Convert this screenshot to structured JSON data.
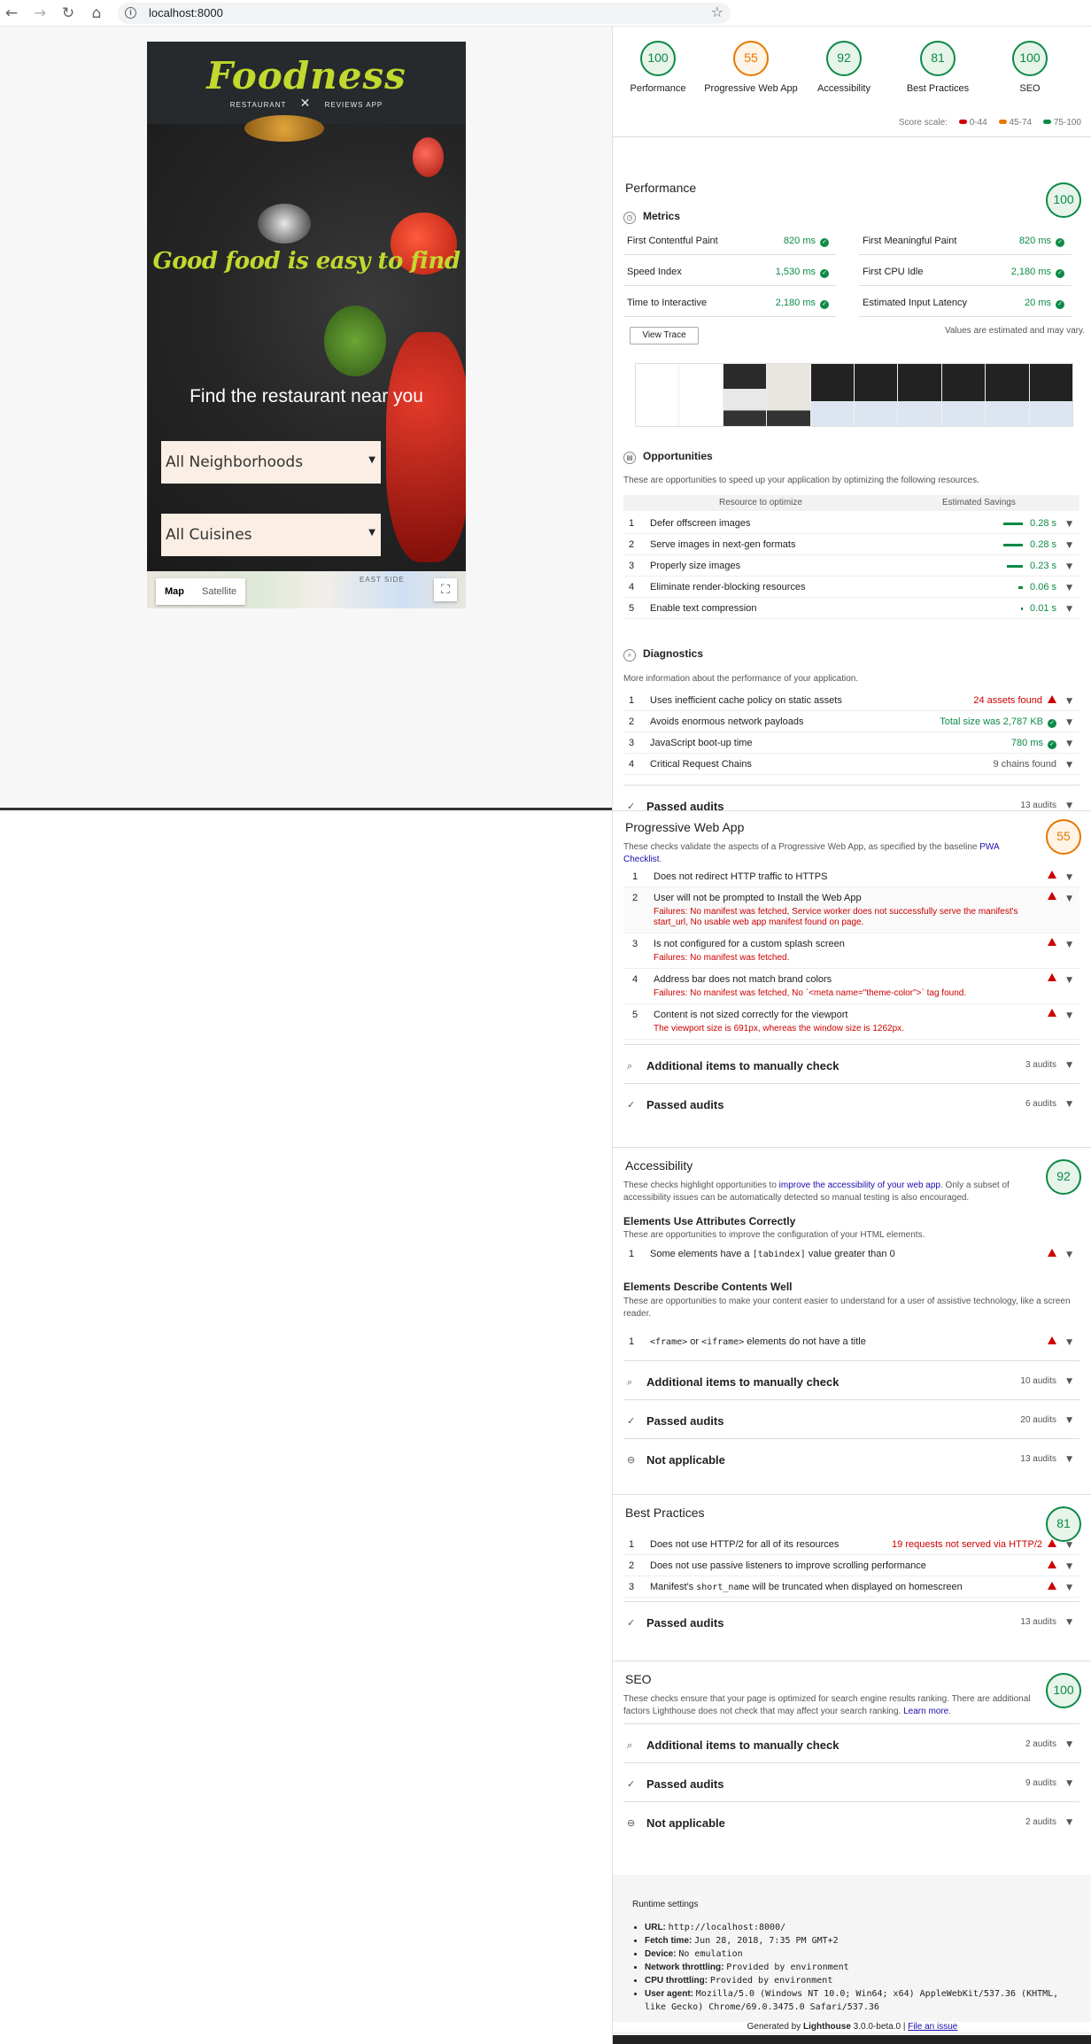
{
  "browser": {
    "url": "localhost:8000"
  },
  "app": {
    "logo": "Foodness",
    "logo_left": "RESTAURANT",
    "logo_right": "REVIEWS APP",
    "hero_title": "Good food is easy to find",
    "hero_subtitle": "Find the restaurant near you",
    "neighborhoods_select": "All Neighborhoods",
    "cuisines_select": "All Cuisines",
    "map_tab": "Map",
    "satellite_tab": "Satellite",
    "map_label": "EAST SIDE"
  },
  "gauges": [
    {
      "score": "100",
      "label": "Performance"
    },
    {
      "score": "55",
      "label": "Progressive Web App"
    },
    {
      "score": "92",
      "label": "Accessibility"
    },
    {
      "score": "81",
      "label": "Best Practices"
    },
    {
      "score": "100",
      "label": "SEO"
    }
  ],
  "scale": {
    "label": "Score scale:",
    "bad": "0-44",
    "avg": "45-74",
    "good": "75-100",
    "colors": {
      "bad": "#cc0000",
      "avg": "#e67700",
      "good": "#0c8a46"
    }
  },
  "performance": {
    "title": "Performance",
    "score": "100",
    "metrics_title": "Metrics",
    "metrics": [
      {
        "name": "First Contentful Paint",
        "value": "820 ms"
      },
      {
        "name": "First Meaningful Paint",
        "value": "820 ms"
      },
      {
        "name": "Speed Index",
        "value": "1,530 ms"
      },
      {
        "name": "First CPU Idle",
        "value": "2,180 ms"
      },
      {
        "name": "Time to Interactive",
        "value": "2,180 ms"
      },
      {
        "name": "Estimated Input Latency",
        "value": "20 ms"
      }
    ],
    "view_trace": "View Trace",
    "estimate_note": "Values are estimated and may vary.",
    "opportunities_title": "Opportunities",
    "opportunities_desc": "These are opportunities to speed up your application by optimizing the following resources.",
    "col_resource": "Resource to optimize",
    "col_savings": "Estimated Savings",
    "opportunities": [
      {
        "n": "1",
        "name": "Defer offscreen images",
        "value": "0.28 s",
        "frac": 1.0
      },
      {
        "n": "2",
        "name": "Serve images in next-gen formats",
        "value": "0.28 s",
        "frac": 1.0
      },
      {
        "n": "3",
        "name": "Properly size images",
        "value": "0.23 s",
        "frac": 0.82
      },
      {
        "n": "4",
        "name": "Eliminate render-blocking resources",
        "value": "0.06 s",
        "frac": 0.21
      },
      {
        "n": "5",
        "name": "Enable text compression",
        "value": "0.01 s",
        "frac": 0.04
      }
    ],
    "diagnostics_title": "Diagnostics",
    "diagnostics_desc": "More information about the performance of your application.",
    "diagnostics": [
      {
        "n": "1",
        "name": "Uses inefficient cache policy on static assets",
        "value": "24 assets found"
      },
      {
        "n": "2",
        "name": "Avoids enormous network payloads",
        "value": "Total size was 2,787 KB"
      },
      {
        "n": "3",
        "name": "JavaScript boot-up time",
        "value": "780 ms"
      },
      {
        "n": "4",
        "name": "Critical Request Chains",
        "value": "9 chains found"
      }
    ],
    "passed": "Passed audits",
    "passed_count": "13 audits"
  },
  "pwa": {
    "title": "Progressive Web App",
    "score": "55",
    "desc": "These checks validate the aspects of a Progressive Web App, as specified by the baseline ",
    "desc_link": "PWA Checklist",
    "desc_end": ".",
    "items": [
      {
        "n": "1",
        "name": "Does not redirect HTTP traffic to HTTPS",
        "fail": ""
      },
      {
        "n": "2",
        "name": "User will not be prompted to Install the Web App",
        "fail": "Failures: No manifest was fetched, Service worker does not successfully serve the manifest's start_url, No usable web app manifest found on page."
      },
      {
        "n": "3",
        "name": "Is not configured for a custom splash screen",
        "fail": "Failures: No manifest was fetched."
      },
      {
        "n": "4",
        "name": "Address bar does not match brand colors",
        "fail": "Failures: No manifest was fetched, No `<meta name=\"theme-color\">` tag found."
      },
      {
        "n": "5",
        "name": "Content is not sized correctly for the viewport",
        "fail": "The viewport size is 691px, whereas the window size is 1262px."
      }
    ],
    "manual": "Additional items to manually check",
    "manual_count": "3 audits",
    "passed": "Passed audits",
    "passed_count": "6 audits"
  },
  "a11y": {
    "title": "Accessibility",
    "score": "92",
    "desc": "These checks highlight opportunities to ",
    "desc_link": "improve the accessibility of your web app",
    "desc_end": ". Only a subset of accessibility issues can be automatically detected so manual testing is also encouraged.",
    "grp1_title": "Elements Use Attributes Correctly",
    "grp1_desc": "These are opportunities to improve the configuration of your HTML elements.",
    "grp1_item_pre": "Some elements have a ",
    "grp1_item_code": "[tabindex]",
    "grp1_item_post": " value greater than 0",
    "grp2_title": "Elements Describe Contents Well",
    "grp2_desc": "These are opportunities to make your content easier to understand for a user of assistive technology, like a screen reader.",
    "grp2_code1": "<frame>",
    "grp2_or": " or ",
    "grp2_code2": "<iframe>",
    "grp2_post": " elements do not have a title",
    "manual": "Additional items to manually check",
    "manual_count": "10 audits",
    "passed": "Passed audits",
    "passed_count": "20 audits",
    "na": "Not applicable",
    "na_count": "13 audits"
  },
  "bp": {
    "title": "Best Practices",
    "score": "81",
    "item1": "Does not use HTTP/2 for all of its resources",
    "item1_value": "19 requests not served via HTTP/2",
    "item2": "Does not use passive listeners to improve scrolling performance",
    "item3_pre": "Manifest's ",
    "item3_code": "short_name",
    "item3_post": " will be truncated when displayed on homescreen",
    "passed": "Passed audits",
    "passed_count": "13 audits"
  },
  "seo": {
    "title": "SEO",
    "score": "100",
    "desc": "These checks ensure that your page is optimized for search engine results ranking. There are additional factors Lighthouse does not check that may affect your search ranking. ",
    "desc_link": "Learn more",
    "desc_end": ".",
    "manual": "Additional items to manually check",
    "manual_count": "2 audits",
    "passed": "Passed audits",
    "passed_count": "9 audits",
    "na": "Not applicable",
    "na_count": "2 audits"
  },
  "runtime": {
    "title": "Runtime settings",
    "url_label": "URL:",
    "url": "http://localhost:8000/",
    "fetch_label": "Fetch time:",
    "fetch": "Jun 28, 2018, 7:35 PM GMT+2",
    "device_label": "Device:",
    "device": "No emulation",
    "net_label": "Network throttling:",
    "net": "Provided by environment",
    "cpu_label": "CPU throttling:",
    "cpu": "Provided by environment",
    "ua_label": "User agent:",
    "ua": "Mozilla/5.0 (Windows NT 10.0; Win64; x64) AppleWebKit/537.36 (KHTML, like Gecko) Chrome/69.0.3475.0 Safari/537.36"
  },
  "footer": {
    "pre": "Generated by ",
    "brand": "Lighthouse",
    "version": " 3.0.0-beta.0 | ",
    "issue": "File an issue"
  }
}
